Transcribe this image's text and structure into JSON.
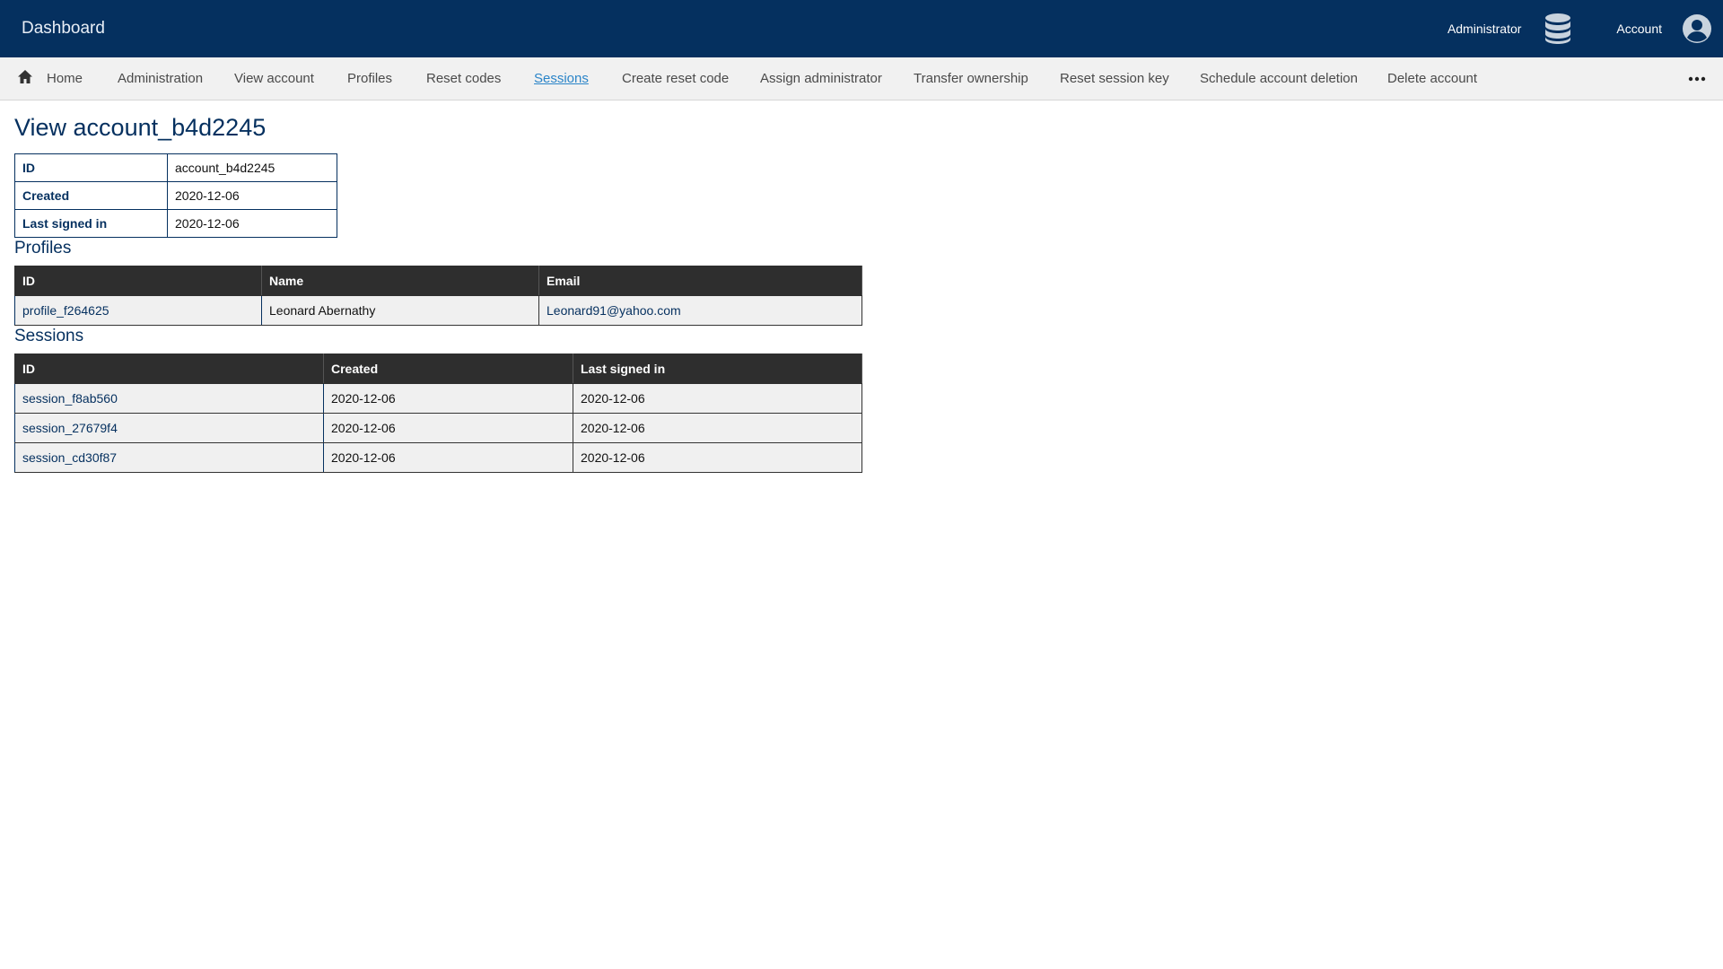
{
  "topbar": {
    "brand": "Dashboard",
    "admin_label": "Administrator",
    "admin_icon": "database-icon",
    "account_label": "Account",
    "account_icon": "user-circle-icon",
    "background": "#05305f"
  },
  "nav": {
    "home_icon": "home-icon",
    "items": [
      {
        "label": "Home"
      },
      {
        "label": "Administration"
      },
      {
        "label": "View account"
      },
      {
        "label": "Profiles"
      },
      {
        "label": "Reset codes"
      },
      {
        "label": "Sessions"
      },
      {
        "label": "Create reset code"
      },
      {
        "label": "Assign administrator"
      },
      {
        "label": "Transfer ownership"
      },
      {
        "label": "Reset session key"
      },
      {
        "label": "Schedule account deletion"
      },
      {
        "label": "Delete account"
      }
    ],
    "active_item": "Sessions",
    "more_icon": "more-horizontal-icon"
  },
  "page": {
    "title": "View account_b4d2245"
  },
  "details": {
    "rows": [
      {
        "key": "ID",
        "value": "account_b4d2245"
      },
      {
        "key": "Created",
        "value": "2020-12-06"
      },
      {
        "key": "Last signed in",
        "value": "2020-12-06"
      }
    ]
  },
  "profiles": {
    "title": "Profiles",
    "headers": [
      "ID",
      "Name",
      "Email"
    ],
    "rows": [
      [
        "profile_f264625",
        "Leonard Abernathy",
        "Leonard91@yahoo.com"
      ]
    ]
  },
  "sessions": {
    "title": "Sessions",
    "headers": [
      "ID",
      "Created",
      "Last signed in"
    ],
    "rows": [
      [
        "session_f8ab560",
        "2020-12-06",
        "2020-12-06"
      ],
      [
        "session_27679f4",
        "2020-12-06",
        "2020-12-06"
      ],
      [
        "session_cd30f87",
        "2020-12-06",
        "2020-12-06"
      ]
    ]
  }
}
